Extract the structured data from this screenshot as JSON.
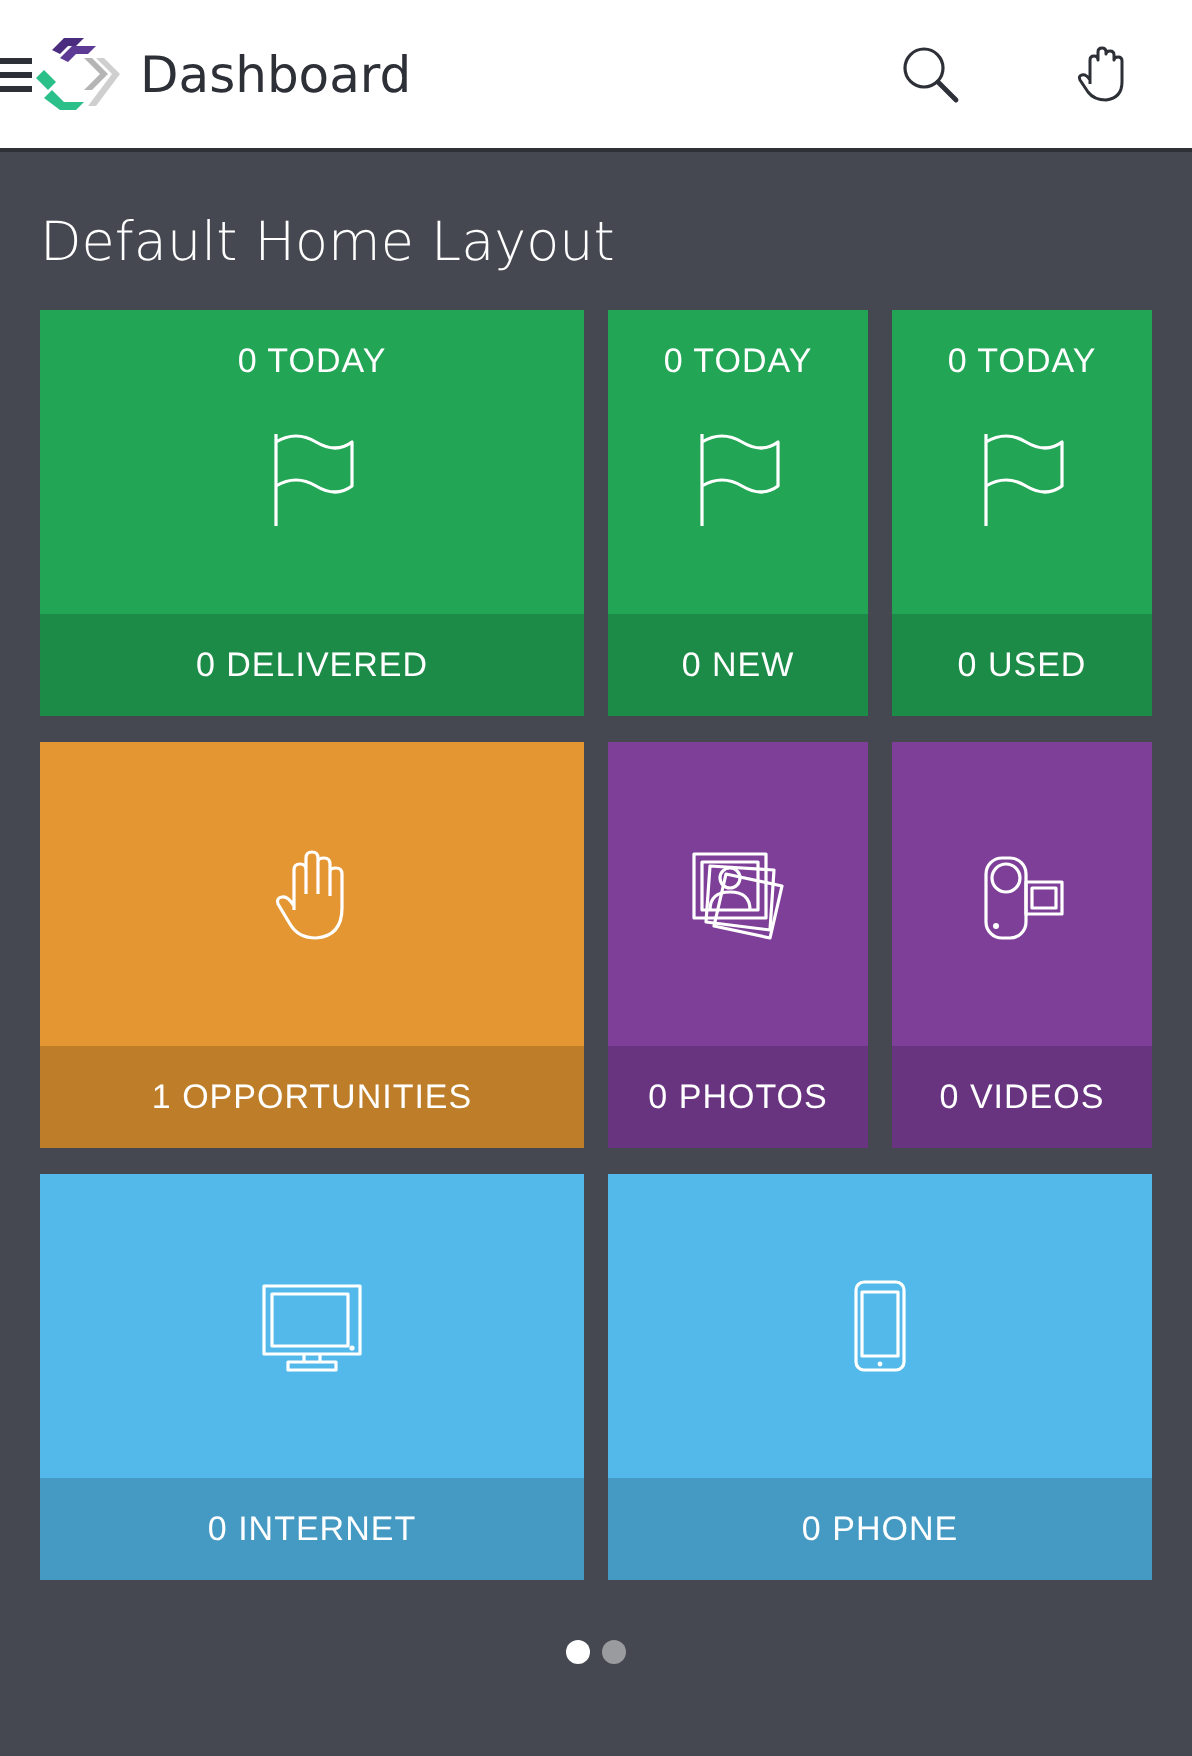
{
  "header": {
    "title": "Dashboard"
  },
  "page_title": "Default Home Layout",
  "tiles": [
    {
      "top": "0 TODAY",
      "kind": "flag",
      "label": "0 DELIVERED",
      "color": "#22a655",
      "wide": true
    },
    {
      "top": "0 TODAY",
      "kind": "flag",
      "label": "0 NEW",
      "color": "#22a655",
      "wide": false
    },
    {
      "top": "0 TODAY",
      "kind": "flag",
      "label": "0 USED",
      "color": "#22a655",
      "wide": false
    },
    {
      "kind": "hand",
      "label": "1 OPPORTUNITIES",
      "color": "#e39632",
      "wide": true
    },
    {
      "kind": "photos",
      "label": "0 PHOTOS",
      "color": "#7d3f98",
      "wide": false
    },
    {
      "kind": "camera",
      "label": "0 VIDEOS",
      "color": "#7d3f98",
      "wide": false
    },
    {
      "kind": "monitor",
      "label": "0 INTERNET",
      "color": "#53b8ea",
      "wide": true
    },
    {
      "kind": "phone",
      "label": "0 PHONE",
      "color": "#53b8ea",
      "wide": true
    }
  ],
  "pages": [
    {
      "selected": true
    },
    {
      "selected": false
    }
  ]
}
